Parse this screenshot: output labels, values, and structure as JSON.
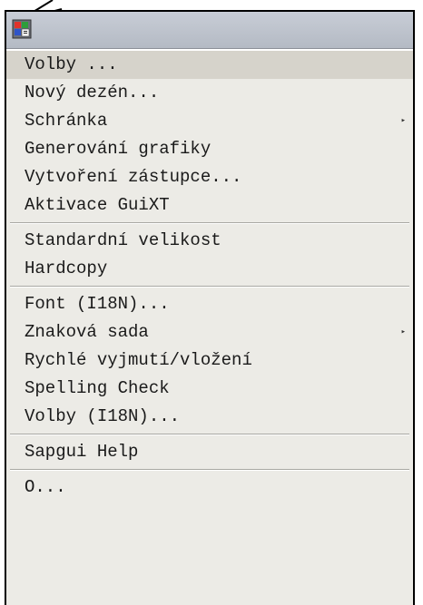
{
  "menu": {
    "items": [
      {
        "label": "Volby ...",
        "submenu": false
      },
      {
        "label": "Nový dezén...",
        "submenu": false
      },
      {
        "label": "Schránka",
        "submenu": true
      },
      {
        "label": "Generování grafiky",
        "submenu": false
      },
      {
        "label": "Vytvoření zástupce...",
        "submenu": false
      },
      {
        "label": "Aktivace GuiXT",
        "submenu": false
      },
      {
        "label": "Standardní velikost",
        "submenu": false
      },
      {
        "label": "Hardcopy",
        "submenu": false
      },
      {
        "label": "Font (I18N)...",
        "submenu": false
      },
      {
        "label": "Znaková sada",
        "submenu": true
      },
      {
        "label": "Rychlé vyjmutí/vložení",
        "submenu": false
      },
      {
        "label": "Spelling Check",
        "submenu": false
      },
      {
        "label": "Volby (I18N)...",
        "submenu": false
      },
      {
        "label": "Sapgui Help",
        "submenu": false
      },
      {
        "label": "O...",
        "submenu": false
      }
    ],
    "submenu_arrow": "▸"
  },
  "icons": {
    "system_menu": "sapgui-system-menu-icon",
    "callout": "callout-pointer"
  },
  "colors": {
    "menu_background": "#ecebe6",
    "highlight": "#d6d3cb",
    "titlebar": "#b4bac4",
    "border": "#000000"
  }
}
